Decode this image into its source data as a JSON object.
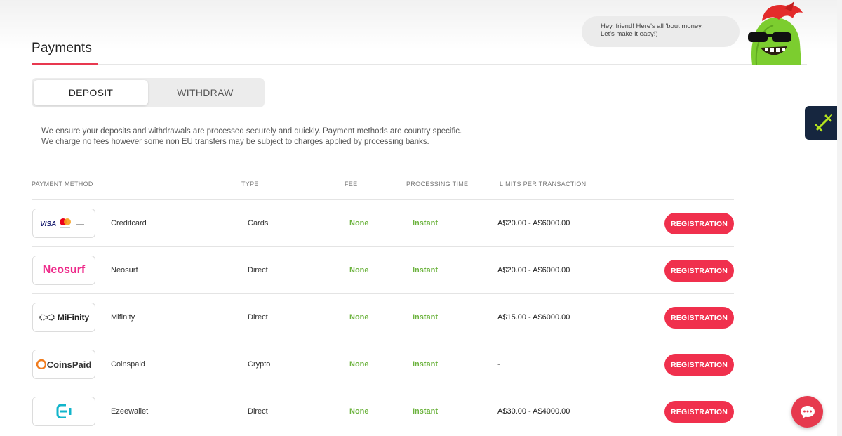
{
  "page": {
    "title": "Payments",
    "bubble_line1": "Hey, friend! Here's all 'bout money.",
    "bubble_line2": "Let's make it easy!)"
  },
  "tabs": [
    {
      "label": "DEPOSIT",
      "active": true
    },
    {
      "label": "WITHDRAW",
      "active": false
    }
  ],
  "description": {
    "line1": "We ensure your deposits and withdrawals are processed securely and quickly. Payment methods are country specific.",
    "line2": "We charge no fees however some non EU transfers may be subject to charges applied by processing banks."
  },
  "table": {
    "headers": {
      "method": "PAYMENT METHOD",
      "type": "TYPE",
      "fee": "FEE",
      "time": "PROCESSING TIME",
      "limits": "LIMITS PER TRANSACTION"
    },
    "rows": [
      {
        "logo": "visa-mastercard-logo",
        "logo_text": "VISA",
        "name": "Creditcard",
        "type": "Cards",
        "fee": "None",
        "time": "Instant",
        "limits": "A$20.00 - A$6000.00",
        "button": "REGISTRATION"
      },
      {
        "logo": "neosurf-logo",
        "logo_text": "Neosurf",
        "name": "Neosurf",
        "type": "Direct",
        "fee": "None",
        "time": "Instant",
        "limits": "A$20.00 - A$6000.00",
        "button": "REGISTRATION"
      },
      {
        "logo": "mifinity-logo",
        "logo_text": "MiFinity",
        "name": "Mifinity",
        "type": "Direct",
        "fee": "None",
        "time": "Instant",
        "limits": "A$15.00 - A$6000.00",
        "button": "REGISTRATION"
      },
      {
        "logo": "coinspaid-logo",
        "logo_text": "CoinsPaid",
        "name": "Coinspaid",
        "type": "Crypto",
        "fee": "None",
        "time": "Instant",
        "limits": "-",
        "button": "REGISTRATION"
      },
      {
        "logo": "ezeewallet-logo",
        "logo_text": "",
        "name": "Ezeewallet",
        "type": "Direct",
        "fee": "None",
        "time": "Instant",
        "limits": "A$30.00 - A$4000.00",
        "button": "REGISTRATION"
      }
    ]
  },
  "colors": {
    "accent": "#f0304d",
    "success": "#6cb33e",
    "side_badge": "#16263f"
  },
  "icons": {
    "side_badge": "sword-icon",
    "chat": "chat-icon",
    "mascot": "mascot-icon"
  }
}
